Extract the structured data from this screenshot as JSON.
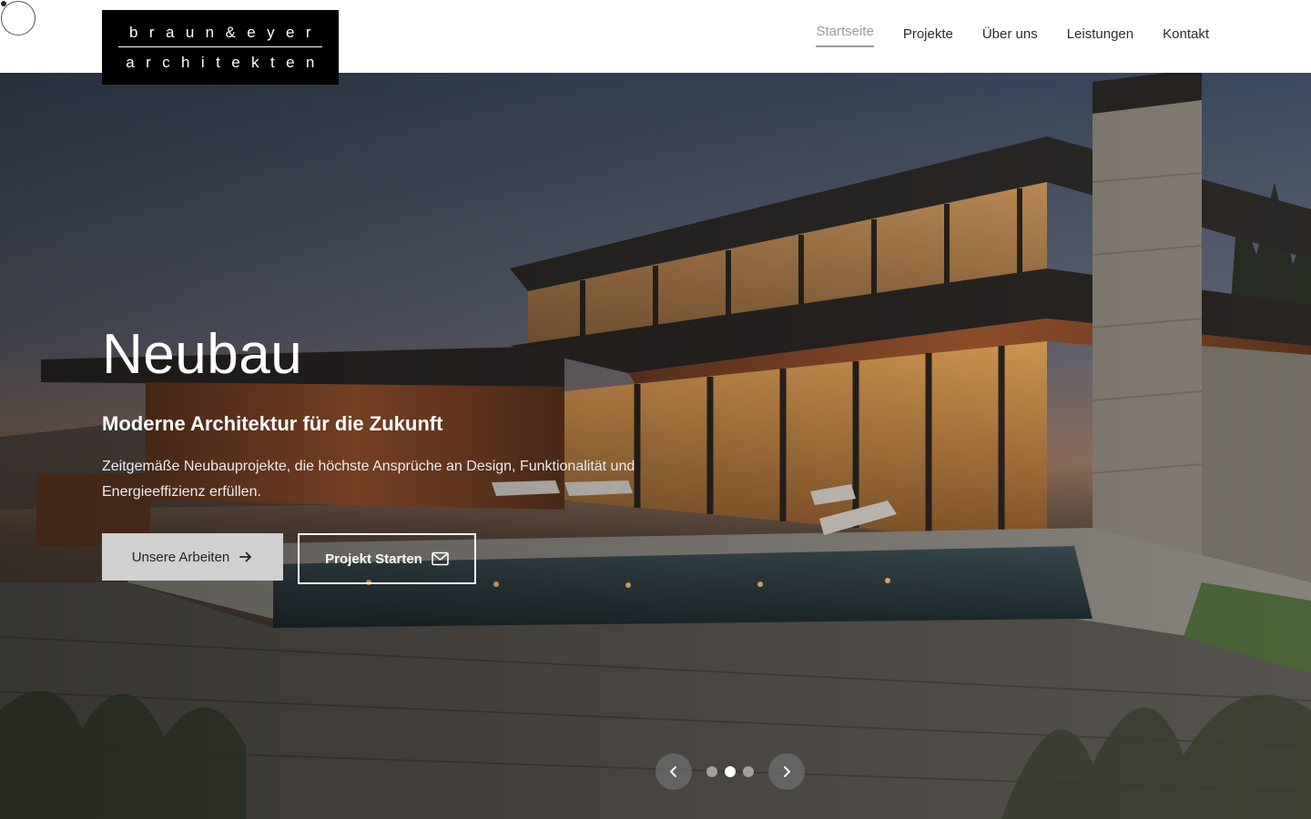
{
  "brand": {
    "line1": "braun&eyer",
    "line2": "architekten"
  },
  "nav": {
    "items": [
      {
        "label": "Startseite",
        "active": true
      },
      {
        "label": "Projekte",
        "active": false
      },
      {
        "label": "Über uns",
        "active": false
      },
      {
        "label": "Leistungen",
        "active": false
      },
      {
        "label": "Kontakt",
        "active": false
      }
    ]
  },
  "hero": {
    "title": "Neubau",
    "subtitle": "Moderne Architektur für die Zukunft",
    "text": "Zeitgemäße Neubauprojekte, die höchste Ansprüche an Design, Funktionalität und Energieeffizienz erfüllen.",
    "primary_button": {
      "label": "Unsere Arbeiten",
      "icon": "arrow-right-icon"
    },
    "secondary_button": {
      "label": "Projekt Starten",
      "icon": "mail-icon"
    }
  },
  "carousel": {
    "slide_count": 3,
    "active_slide": 2,
    "prev_icon": "chevron-left-icon",
    "next_icon": "chevron-right-icon"
  },
  "colors": {
    "nav_active": "#9c9c9c",
    "nav_text": "#2b2b2b",
    "logo_bg": "#000000",
    "primary_button_bg": "#d0d0d0"
  }
}
